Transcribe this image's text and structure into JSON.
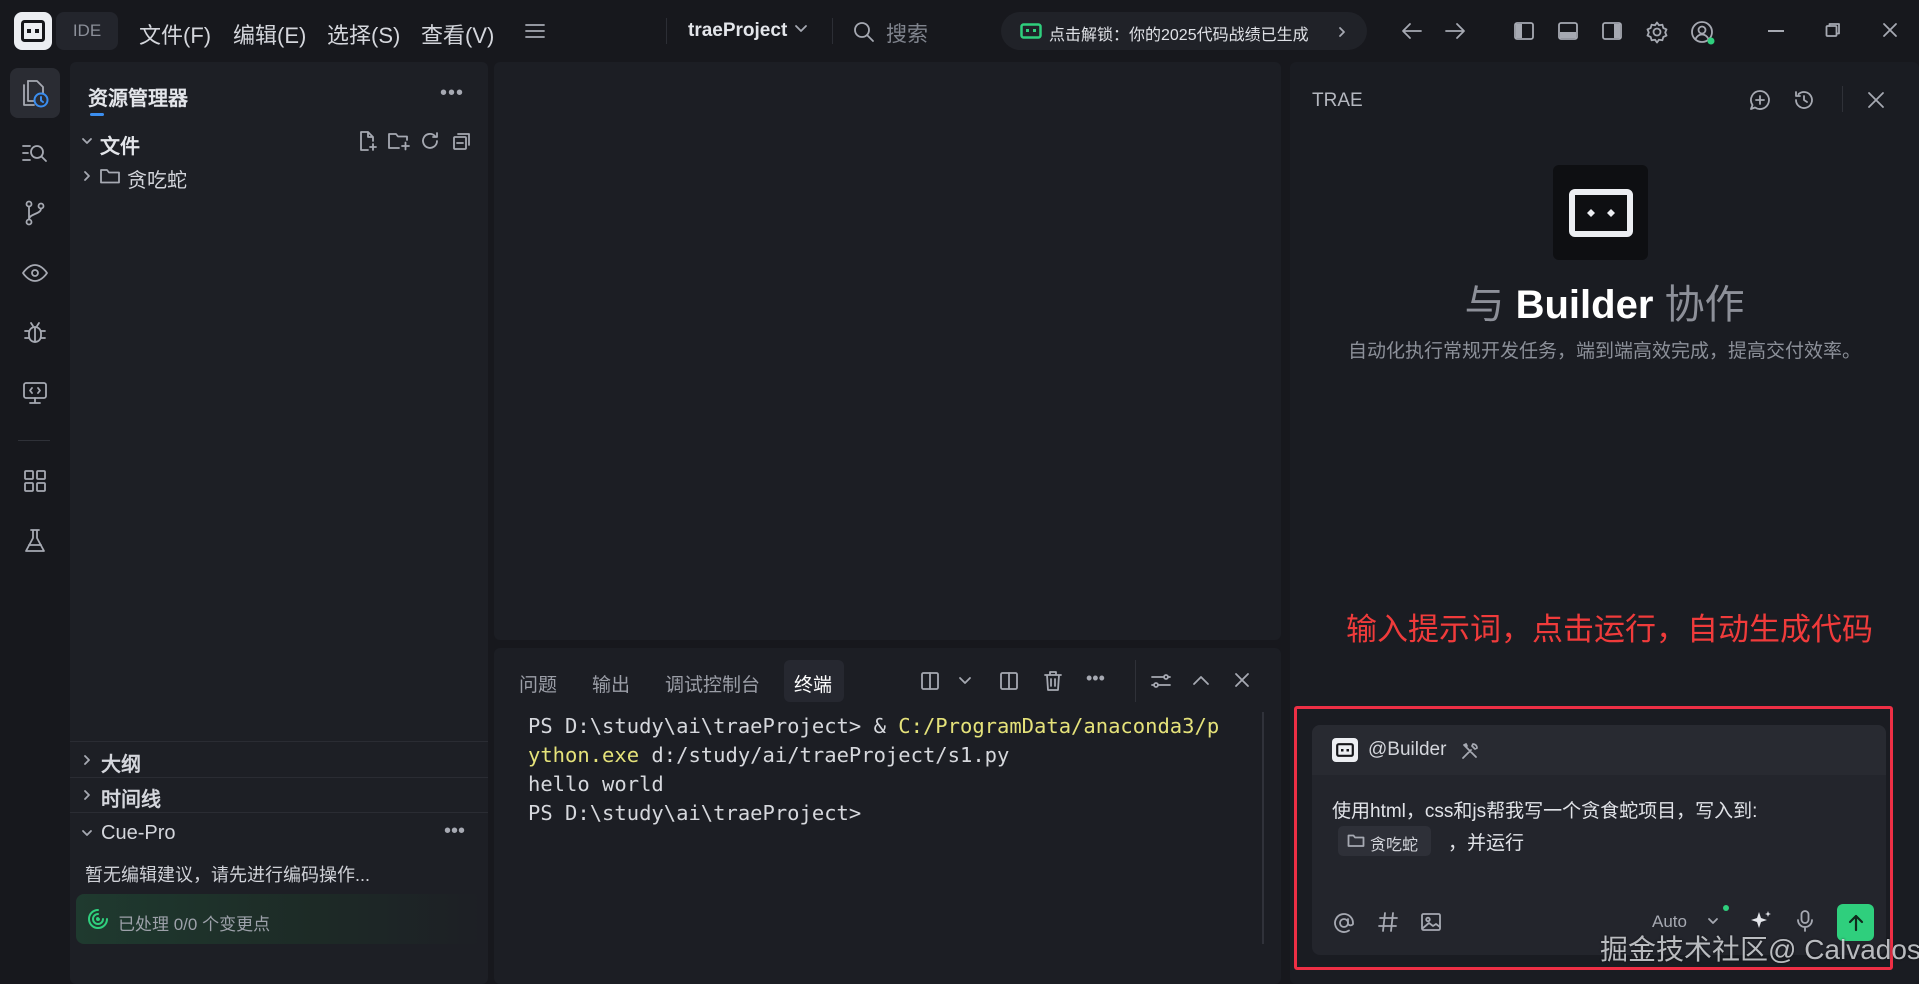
{
  "titlebar": {
    "ide_label": "IDE",
    "menu": [
      "文件(F)",
      "编辑(E)",
      "选择(S)",
      "查看(V)"
    ],
    "project_name": "traeProject",
    "search_label": "搜索",
    "banner_text": "点击解锁：你的2025代码战绩已生成"
  },
  "explorer": {
    "title": "资源管理器",
    "files_section": "文件",
    "tree": [
      {
        "type": "folder",
        "label": "贪吃蛇"
      }
    ],
    "sections": [
      "大纲",
      "时间线"
    ],
    "cue": {
      "title": "Cue-Pro",
      "message": "暂无编辑建议，请先进行编码操作...",
      "status": "已处理 0/0 个变更点"
    }
  },
  "terminal": {
    "tabs": [
      "问题",
      "输出",
      "调试控制台",
      "终端"
    ],
    "active_tab": "终端",
    "lines": [
      {
        "prompt": "PS D:\\study\\ai\\traeProject> & ",
        "path": "C:/ProgramData/anaconda3/p"
      },
      {
        "path": "ython.exe",
        "rest": " d:/study/ai/traeProject/s1.py"
      },
      {
        "text": "hello world"
      },
      {
        "text": "PS D:\\study\\ai\\traeProject>"
      }
    ]
  },
  "trae_panel": {
    "title": "TRAE",
    "heading_pre": "与 ",
    "heading_bold": "Builder",
    "heading_post": " 协作",
    "description": "自动化执行常规开发任务，端到端高效完成，提高交付效率。",
    "annotation": "输入提示词，点击运行，自动生成代码",
    "input": {
      "agent_chip": "@Builder",
      "prompt_line1": "使用html，css和js帮我写一个贪食蛇项目，写入到:",
      "folder_chip": "贪吃蛇",
      "prompt_line2": "，并运行",
      "model_label": "Auto"
    }
  },
  "watermark": "掘金技术社区@ Calvados",
  "colors": {
    "accent_green": "#2fcf7d",
    "annotation_red": "#ee2f45",
    "terminal_path": "#e5e27a",
    "link_blue": "#3b8ef0"
  }
}
